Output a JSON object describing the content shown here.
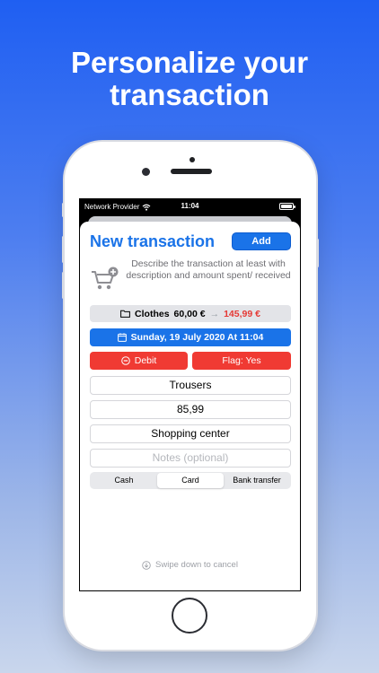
{
  "headline": {
    "line1": "Personalize your",
    "line2": "transaction"
  },
  "status_bar": {
    "carrier": "Network Provider",
    "time": "11:04"
  },
  "sheet": {
    "title": "New transaction",
    "add_label": "Add",
    "hint": "Describe the transaction at least with description and amount spent/ received"
  },
  "category": {
    "name": "Clothes",
    "current_amount": "60,00 €",
    "arrow": "→",
    "new_amount": "145,99 €"
  },
  "date": {
    "label": "Sunday, 19 July 2020 At 11:04"
  },
  "type_buttons": {
    "debit_label": "Debit",
    "flag_label": "Flag: Yes"
  },
  "fields": {
    "description": "Trousers",
    "amount": "85,99",
    "place": "Shopping center",
    "notes_placeholder": "Notes (optional)"
  },
  "payment_methods": {
    "options": [
      "Cash",
      "Card",
      "Bank transfer"
    ],
    "selected": "Card"
  },
  "footer": {
    "swipe_hint": "Swipe down to cancel"
  },
  "colors": {
    "accent": "#1a73e8",
    "debit": "#f03a33",
    "new_amount": "#e53935"
  },
  "icons": {
    "cart": "cart-add-icon",
    "folder": "folder-icon",
    "calendar": "calendar-icon",
    "minus": "minus-circle-icon",
    "down": "arrow-down-circle-icon",
    "wifi": "wifi-icon",
    "battery": "battery-icon"
  }
}
